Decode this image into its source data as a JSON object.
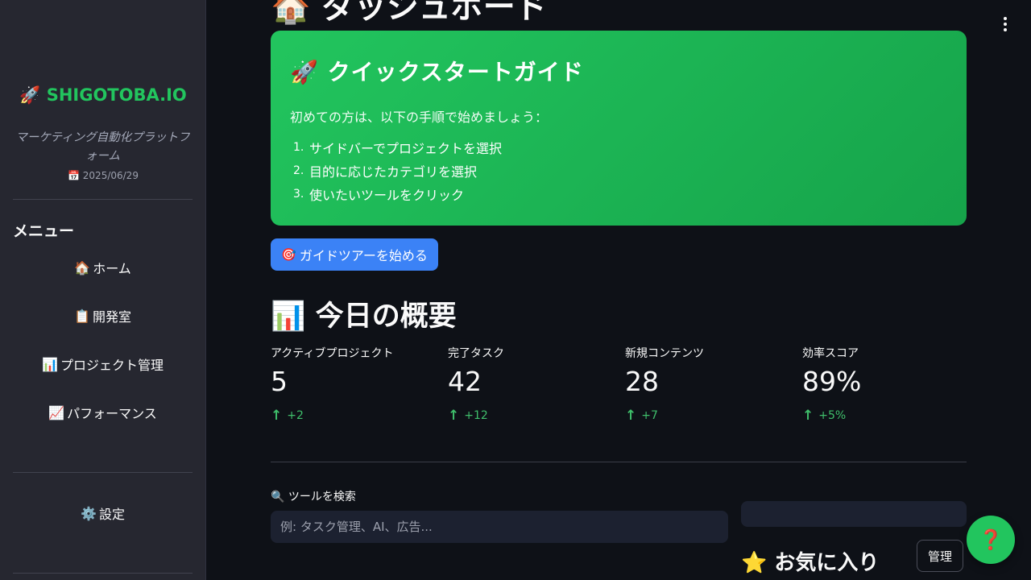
{
  "sidebar": {
    "brand": "🚀 SHIGOTOBA.IO",
    "tagline": "マーケティング自動化プラットフォーム",
    "date": "📅 2025/06/29",
    "menu_title": "メニュー",
    "items": [
      {
        "icon": "🏠",
        "label": "ホーム"
      },
      {
        "icon": "📋",
        "label": "開発室"
      },
      {
        "icon": "📊",
        "label": "プロジェクト管理"
      },
      {
        "icon": "📈",
        "label": "パフォーマンス"
      }
    ],
    "settings": {
      "icon": "⚙️",
      "label": "設定"
    }
  },
  "main": {
    "page_title": "🏠 ダッシュボード",
    "guide": {
      "title": "🚀 クイックスタートガイド",
      "intro": "初めての方は、以下の手順で始めましょう：",
      "steps": [
        {
          "num": "1.",
          "text": "サイドバーでプロジェクトを選択"
        },
        {
          "num": "2.",
          "text": "目的に応じたカテゴリを選択"
        },
        {
          "num": "3.",
          "text": "使いたいツールをクリック"
        }
      ]
    },
    "tour_button": {
      "icon": "🎯",
      "label": "ガイドツアーを始める"
    },
    "overview_title": "📊 今日の概要",
    "metrics": [
      {
        "label": "アクティブプロジェクト",
        "value": "5",
        "delta": "+2"
      },
      {
        "label": "完了タスク",
        "value": "42",
        "delta": "+12"
      },
      {
        "label": "新規コンテンツ",
        "value": "28",
        "delta": "+7"
      },
      {
        "label": "効率スコア",
        "value": "89%",
        "delta": "+5%"
      }
    ],
    "search": {
      "label": "🔍 ツールを検索",
      "placeholder": "例: タスク管理、AI、広告..."
    },
    "favorites_title": "⭐ お気に入り",
    "manage_label": "管理",
    "help_label": "❓"
  },
  "colors": {
    "accent": "#22c55e",
    "button_blue": "#3b82f6",
    "delta_green": "#3fbf6b",
    "background": "#0e1117",
    "sidebar": "#262730"
  }
}
